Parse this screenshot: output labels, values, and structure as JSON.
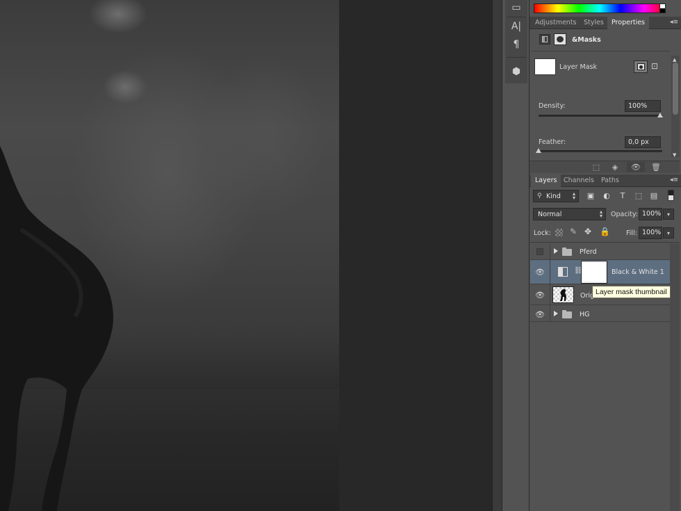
{
  "properties_panel": {
    "tabs": [
      "Adjustments",
      "Styles",
      "Properties"
    ],
    "active_tab": "Properties",
    "header_label": "&Masks",
    "mask_label": "Layer Mask",
    "density_label": "Density:",
    "density_value": "100%",
    "feather_label": "Feather:",
    "feather_value": "0,0 px"
  },
  "layers_panel": {
    "tabs": [
      "Layers",
      "Channels",
      "Paths"
    ],
    "active_tab": "Layers",
    "filter_kind": "Kind",
    "blend_mode": "Normal",
    "opacity_label": "Opacity:",
    "opacity_value": "100%",
    "lock_label": "Lock:",
    "fill_label": "Fill:",
    "fill_value": "100%",
    "layers": [
      {
        "name": "Pferd",
        "type": "group",
        "visible": false
      },
      {
        "name": "Black & White 1",
        "type": "adjustment",
        "visible": true,
        "selected": true
      },
      {
        "name": "Orig",
        "type": "image",
        "visible": true
      },
      {
        "name": "HG",
        "type": "group",
        "visible": true
      }
    ]
  },
  "tooltip": "Layer mask thumbnail",
  "tools": [
    "histogram-icon",
    "character-icon",
    "paragraph-icon",
    "3d-icon"
  ],
  "colors": {
    "panel_bg": "#535353",
    "selected_row": "#5d6e80",
    "tooltip_bg": "#ffffe1"
  }
}
